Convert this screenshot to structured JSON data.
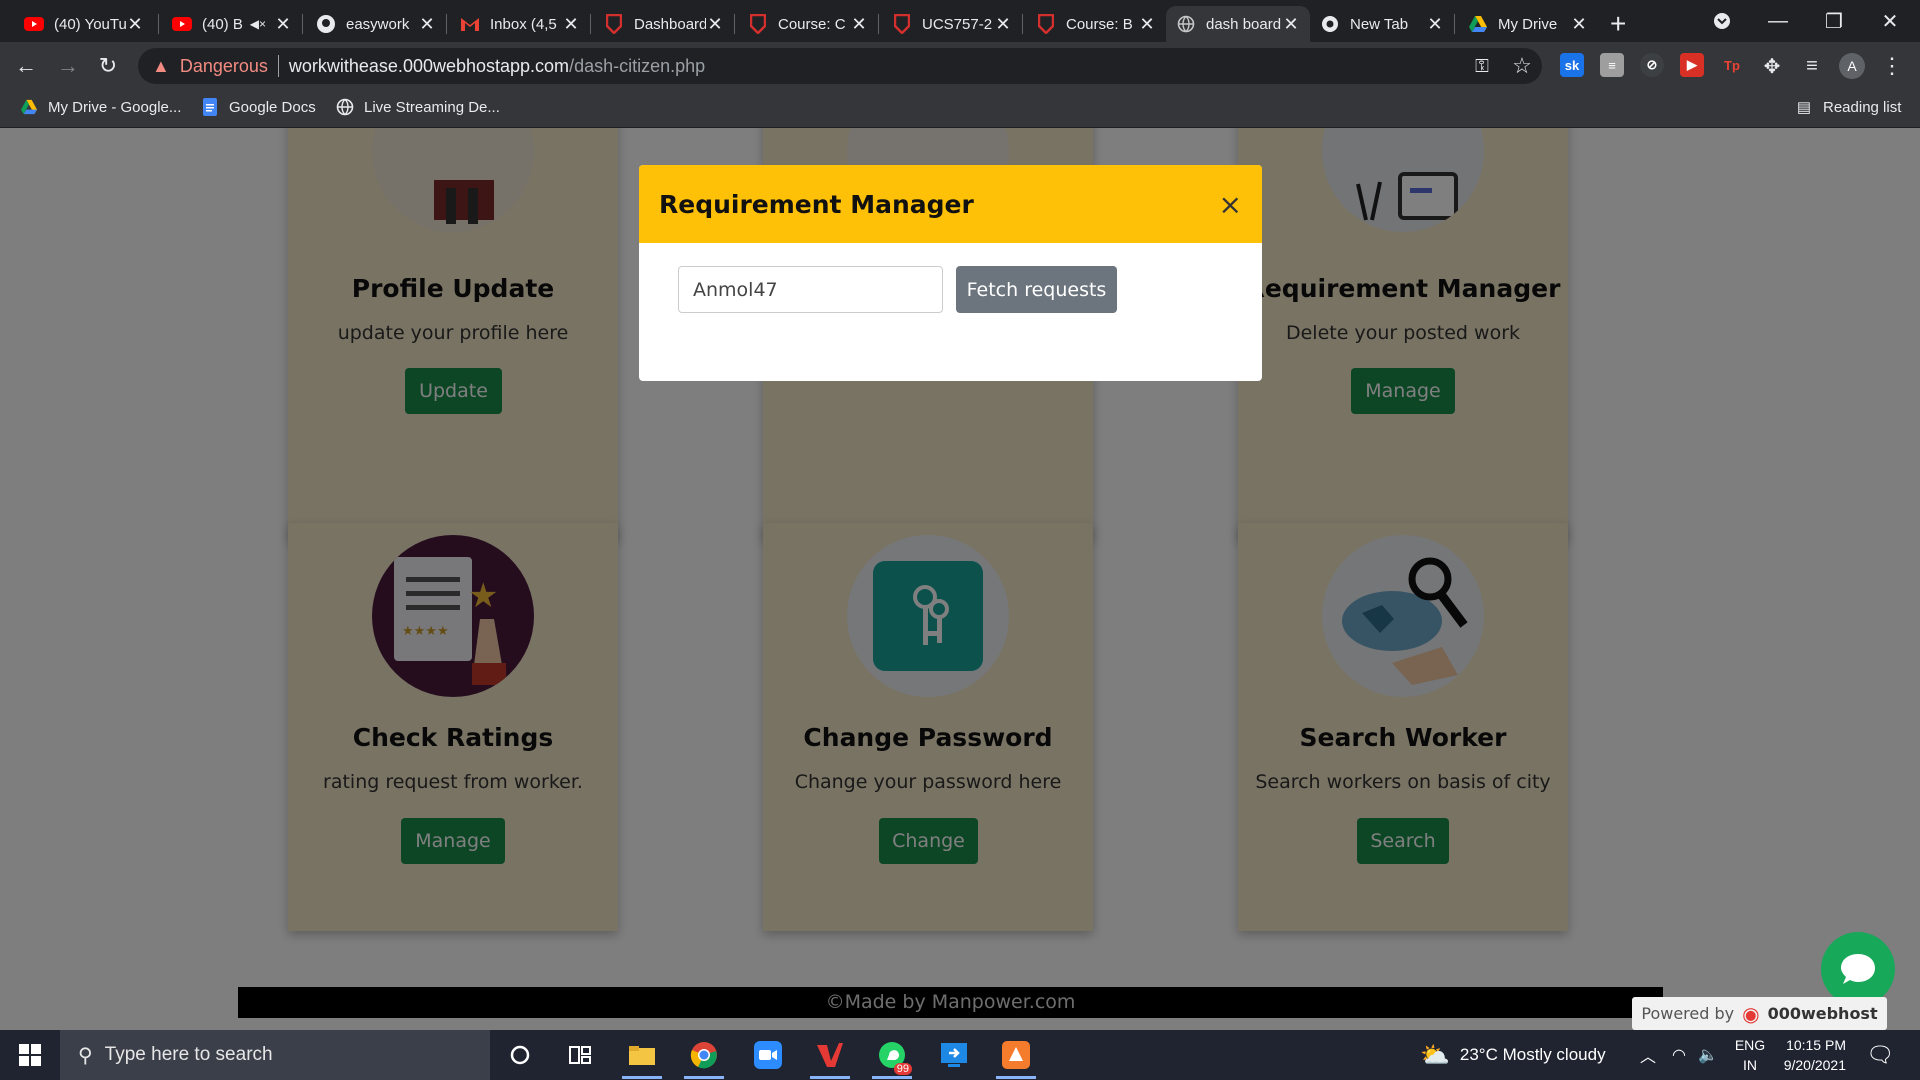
{
  "browser": {
    "tabs": [
      {
        "title": "(40) YouTube",
        "icon": "youtube-icon"
      },
      {
        "title": "(40) B",
        "icon": "youtube-icon",
        "muted": true
      },
      {
        "title": "easywork",
        "icon": "github-icon"
      },
      {
        "title": "Inbox (4,5",
        "icon": "gmail-icon"
      },
      {
        "title": "Dashboard",
        "icon": "shield-icon"
      },
      {
        "title": "Course: C",
        "icon": "shield-icon"
      },
      {
        "title": "UCS757-2",
        "icon": "shield-icon"
      },
      {
        "title": "Course: B",
        "icon": "shield-icon"
      },
      {
        "title": "dash board",
        "icon": "globe-icon",
        "active": true
      },
      {
        "title": "New Tab",
        "icon": "chrome-icon"
      },
      {
        "title": "My Drive",
        "icon": "drive-icon"
      }
    ],
    "security_label": "Dangerous",
    "url_host": "workwithease.000webhostapp.com",
    "url_path": "/dash-citizen.php",
    "profile_initial": "A",
    "bookmarks": [
      {
        "label": "My Drive - Google...",
        "icon": "drive-icon"
      },
      {
        "label": "Google Docs",
        "icon": "docs-icon"
      },
      {
        "label": "Live Streaming De...",
        "icon": "globe-icon"
      }
    ],
    "reading_list": "Reading list"
  },
  "cards": [
    {
      "title": "Profile Update",
      "text": "update your profile here",
      "button": "Update"
    },
    {
      "title": "Requirement Manager",
      "text": "Delete your posted work",
      "button": "Manage"
    },
    {
      "title": "Check Ratings",
      "text": "rating request from worker.",
      "button": "Manage"
    },
    {
      "title": "Change Password",
      "text": "Change your password here",
      "button": "Change"
    },
    {
      "title": "Search Worker",
      "text": "Search workers on basis of city",
      "button": "Search"
    }
  ],
  "footer": "©Made by Manpower.com",
  "modal": {
    "title": "Requirement Manager",
    "close": "×",
    "input_value": "Anmol47",
    "button": "Fetch requests"
  },
  "powered": {
    "prefix": "Powered by",
    "brand": "000webhost"
  },
  "taskbar": {
    "search_placeholder": "Type here to search",
    "whatsapp_badge": "99",
    "weather": "23°C  Mostly cloudy",
    "lang_top": "ENG",
    "lang_bottom": "IN",
    "time": "10:15 PM",
    "date": "9/20/2021"
  },
  "colors": {
    "modal_header": "#ffc107",
    "action_button": "#198c4a",
    "fetch_button": "#6c757d",
    "danger_text": "#f28b82"
  }
}
